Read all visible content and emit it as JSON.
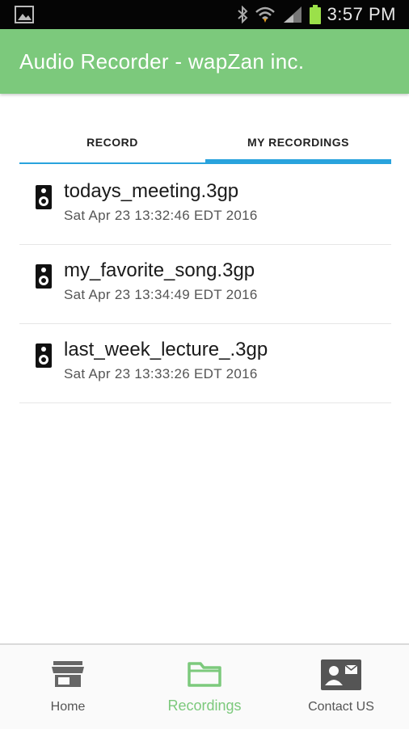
{
  "status": {
    "time": "3:57 PM"
  },
  "appbar": {
    "title": "Audio Recorder - wapZan inc."
  },
  "tabs": [
    {
      "label": "RECORD"
    },
    {
      "label": "MY RECORDINGS"
    }
  ],
  "recordings": [
    {
      "name": "todays_meeting.3gp",
      "date": "Sat Apr 23 13:32:46 EDT 2016"
    },
    {
      "name": "my_favorite_song.3gp",
      "date": "Sat Apr 23 13:34:49 EDT 2016"
    },
    {
      "name": "last_week_lecture_.3gp",
      "date": "Sat Apr 23 13:33:26 EDT 2016"
    }
  ],
  "bottom_nav": [
    {
      "label": "Home",
      "icon": "store-icon"
    },
    {
      "label": "Recordings",
      "icon": "folder-icon"
    },
    {
      "label": "Contact US",
      "icon": "contact-card-icon"
    }
  ],
  "colors": {
    "appbar": "#7cc97c",
    "tab_indicator": "#29a3dd",
    "active_nav": "#7cc97c"
  }
}
